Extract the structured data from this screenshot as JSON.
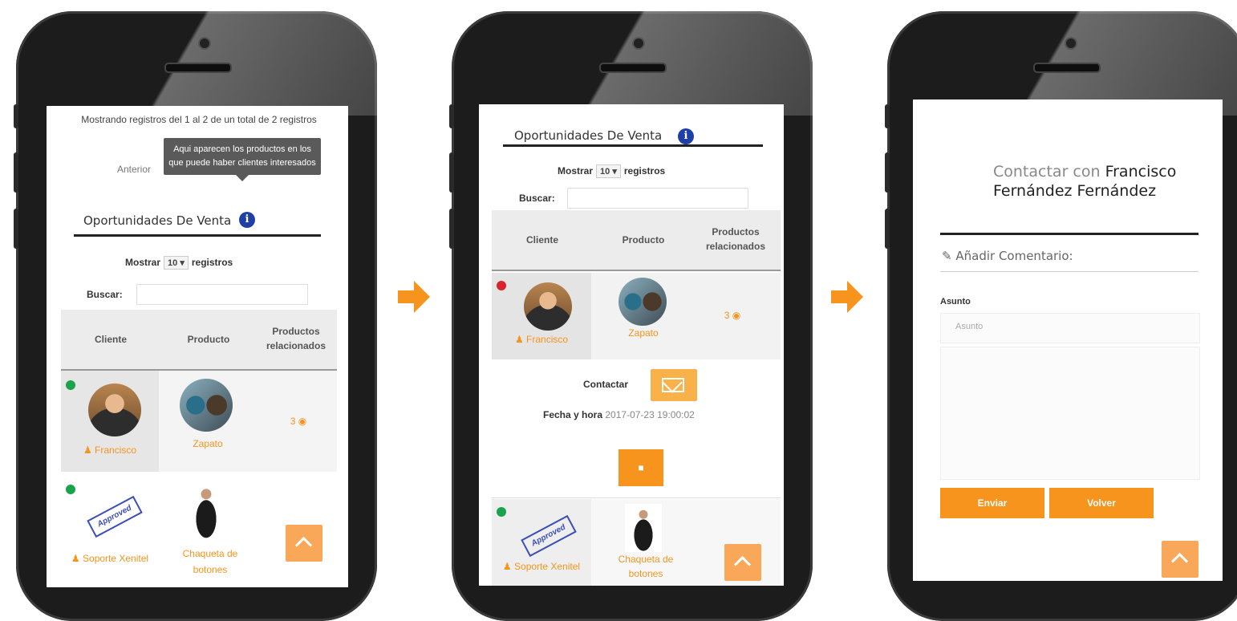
{
  "colors": {
    "accent": "#f7941d",
    "accent_light": "#f9a85a",
    "info": "#1f3fa8",
    "status_ok": "#1aa34a",
    "status_alert": "#d9232d"
  },
  "screen1": {
    "showing_text": "Mostrando registros del 1 al 2 de un total de 2 registros",
    "prev_text": "Anterior",
    "tooltip": "Aqui aparecen los productos en los que puede haber clientes interesados",
    "section_title": "Oportunidades De Venta",
    "show_label": "Mostrar",
    "show_value": "10",
    "show_suffix": "registros",
    "search_label": "Buscar:",
    "headers": [
      "Cliente",
      "Producto",
      "Productos relacionados"
    ],
    "rows": [
      {
        "client": "Francisco",
        "product": "Zapato",
        "related": "3"
      },
      {
        "client": "Soporte Xenitel",
        "product": "Chaqueta de botones",
        "related": ""
      }
    ]
  },
  "screen2": {
    "section_title": "Oportunidades De Venta",
    "show_label": "Mostrar",
    "show_value": "10",
    "show_suffix": "registros",
    "search_label": "Buscar:",
    "headers": [
      "Cliente",
      "Producto",
      "Productos relacionados"
    ],
    "rows": [
      {
        "client": "Francisco",
        "product": "Zapato",
        "related": "3"
      },
      {
        "client": "Soporte Xenitel",
        "product": "Chaqueta de botones",
        "related": ""
      }
    ],
    "contact_label": "Contactar",
    "datetime_label": "Fecha y hora",
    "datetime_value": "2017-07-23 19:00:02"
  },
  "screen3": {
    "title_prefix": "Contactar con",
    "title_name": "Francisco Fernández Fernández",
    "comment_heading": "Añadir Comentario:",
    "subject_label": "Asunto",
    "subject_placeholder": "Asunto",
    "send_label": "Enviar",
    "back_label": "Volver"
  },
  "icons": [
    "info-icon",
    "user-icon",
    "eye-icon",
    "envelope-icon",
    "edit-icon",
    "chevron-up-icon",
    "arrow-right-icon"
  ]
}
